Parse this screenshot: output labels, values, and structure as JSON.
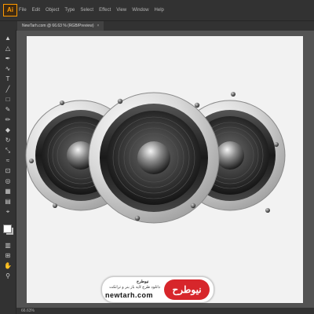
{
  "app": {
    "logo_text": "Ai"
  },
  "menubar": {
    "items": [
      {
        "name": "menu-file",
        "label": "File"
      },
      {
        "name": "menu-edit",
        "label": "Edit"
      },
      {
        "name": "menu-object",
        "label": "Object"
      },
      {
        "name": "menu-type",
        "label": "Type"
      },
      {
        "name": "menu-select",
        "label": "Select"
      },
      {
        "name": "menu-effect",
        "label": "Effect"
      },
      {
        "name": "menu-view",
        "label": "View"
      },
      {
        "name": "menu-window",
        "label": "Window"
      },
      {
        "name": "menu-help",
        "label": "Help"
      }
    ]
  },
  "document_tab": {
    "title": "NewTarh.com @ 66.63 % (RGB/Preview)",
    "close": "×"
  },
  "tools": [
    "selection-tool-icon",
    "direct-selection-tool-icon",
    "pen-tool-icon",
    "curvature-tool-icon",
    "type-tool-icon",
    "line-tool-icon",
    "rectangle-tool-icon",
    "paintbrush-tool-icon",
    "pencil-tool-icon",
    "eraser-tool-icon",
    "rotate-tool-icon",
    "scale-tool-icon",
    "width-tool-icon",
    "free-transform-tool-icon",
    "shape-builder-tool-icon",
    "perspective-grid-tool-icon",
    "mesh-tool-icon",
    "gradient-tool-icon",
    "eyedropper-tool-icon",
    "blend-tool-icon",
    "symbol-sprayer-tool-icon",
    "column-graph-tool-icon",
    "artboard-tool-icon",
    "slice-tool-icon",
    "hand-tool-icon",
    "zoom-tool-icon"
  ],
  "colors": {
    "accent": "#ff9a00",
    "panel": "#323232",
    "canvas": "#535353",
    "artboard": "#f2f2f2",
    "brand_red": "#d7262b"
  },
  "watermark": {
    "brand_fa": "نیوطرح",
    "name_fa": "نیوطرح",
    "tagline_fa": "دانلود طرح لایه باز بنر و ترانکت",
    "url": "newtarh.com"
  },
  "status": {
    "zoom": "66.63%"
  }
}
